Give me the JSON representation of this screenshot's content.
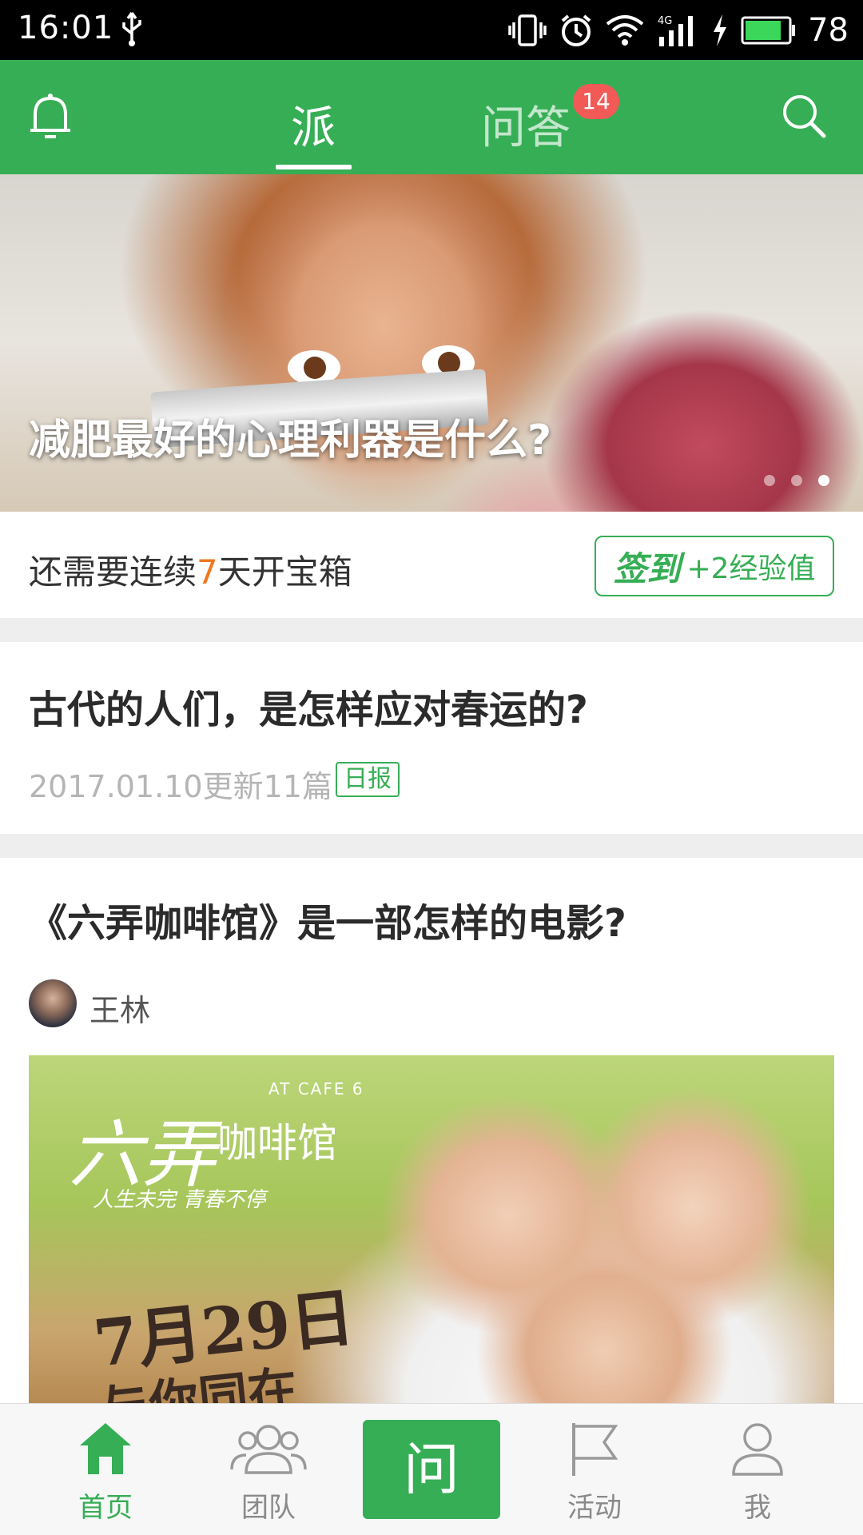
{
  "status_bar": {
    "time": "16:01",
    "network": "4G",
    "battery": "78"
  },
  "header": {
    "tabs": [
      {
        "label": "派",
        "active": true
      },
      {
        "label": "问答",
        "active": false,
        "badge": "14"
      }
    ],
    "accent_color": "#36ae55"
  },
  "banner": {
    "caption": "减肥最好的心理利器是什么?",
    "page_count": 3,
    "active_page": 3
  },
  "checkin": {
    "prefix": "还需要连续",
    "days": "7",
    "suffix": "天开宝箱",
    "button_main": "签到",
    "button_sub": "+2经验值"
  },
  "feed": [
    {
      "title": "古代的人们，是怎样应对春运的?",
      "meta": "2017.01.10更新11篇",
      "tag": "日报"
    },
    {
      "title": "《六弄咖啡馆》是一部怎样的电影?",
      "author": "王林",
      "poster": {
        "title_big": "六弄",
        "title_small": "咖啡馆",
        "en": "AT CAFE 6",
        "tagline": "人生未完 青春不停",
        "date": "7月29日",
        "slogan": "与你同在"
      }
    }
  ],
  "bottom_nav": [
    {
      "label": "首页",
      "icon": "home-icon",
      "active": true
    },
    {
      "label": "团队",
      "icon": "team-icon",
      "active": false
    },
    {
      "label": "问",
      "icon": "ask-icon",
      "active": false
    },
    {
      "label": "活动",
      "icon": "flag-icon",
      "active": false
    },
    {
      "label": "我",
      "icon": "user-icon",
      "active": false
    }
  ]
}
